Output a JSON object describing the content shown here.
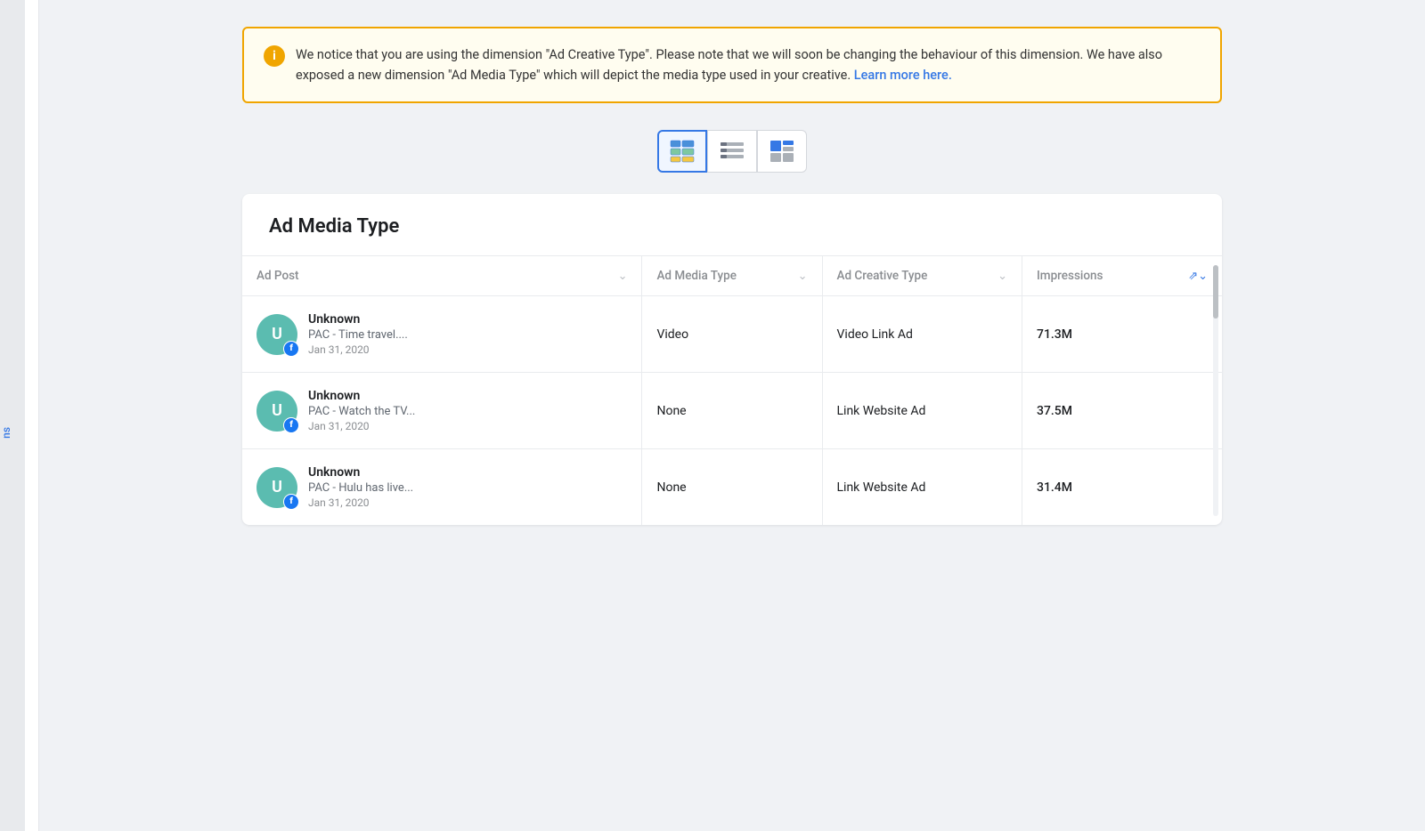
{
  "alert": {
    "text1": "We notice that you are using the dimension \"Ad Creative Type\". Please note that we will soon be changing the behaviour of this dimension. We have also exposed a new dimension \"Ad Media Type\" which will depict the media type used in your creative.",
    "link_text": "Learn more here.",
    "link_url": "#"
  },
  "view_toggle": {
    "buttons": [
      {
        "id": "grid-view",
        "label": "Grid view"
      },
      {
        "id": "list-view",
        "label": "List view"
      },
      {
        "id": "chart-view",
        "label": "Chart view"
      }
    ]
  },
  "table": {
    "title": "Ad Media Type",
    "columns": [
      {
        "key": "ad_post",
        "label": "Ad Post"
      },
      {
        "key": "ad_media_type",
        "label": "Ad Media Type"
      },
      {
        "key": "ad_creative_type",
        "label": "Ad Creative Type"
      },
      {
        "key": "impressions",
        "label": "Impressions"
      }
    ],
    "rows": [
      {
        "avatar_letter": "U",
        "name": "Unknown",
        "description": "PAC - Time travel....",
        "date": "Jan 31, 2020",
        "ad_media_type": "Video",
        "ad_creative_type": "Video Link Ad",
        "impressions": "71.3M"
      },
      {
        "avatar_letter": "U",
        "name": "Unknown",
        "description": "PAC - Watch the TV...",
        "date": "Jan 31, 2020",
        "ad_media_type": "None",
        "ad_creative_type": "Link Website Ad",
        "impressions": "37.5M"
      },
      {
        "avatar_letter": "U",
        "name": "Unknown",
        "description": "PAC - Hulu has live...",
        "date": "Jan 31, 2020",
        "ad_media_type": "None",
        "ad_creative_type": "Link Website Ad",
        "impressions": "31.4M"
      }
    ]
  },
  "sidebar": {
    "nav_text": "ns"
  }
}
